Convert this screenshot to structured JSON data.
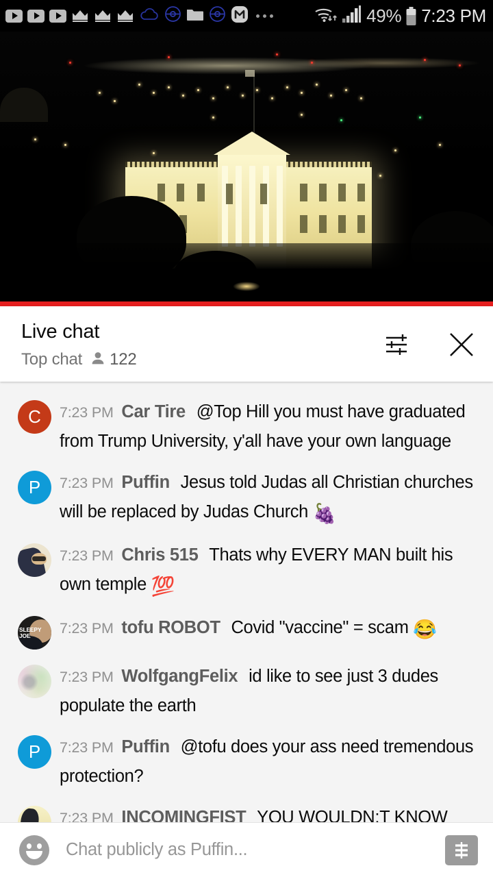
{
  "statusbar": {
    "icons": [
      "youtube-icon",
      "youtube-icon",
      "youtube-icon",
      "crown-icon",
      "crown-icon",
      "crown-icon",
      "cloud-icon",
      "pokeball-icon",
      "folder-icon",
      "pokeball-icon",
      "mega-m-icon",
      "overflow-dots-icon"
    ],
    "wifi_icon": "wifi-data-transfer-icon",
    "signal_icon": "cellular-signal-icon",
    "battery_percent": "49%",
    "battery_icon": "battery-icon",
    "time": "7:23 PM"
  },
  "video": {
    "name": "white-house-night-livestream",
    "progress_color": "#e61f1f",
    "progress_percent": 100
  },
  "chat_header": {
    "title": "Live chat",
    "mode_label": "Top chat",
    "viewer_icon": "person-icon",
    "viewer_count": "122",
    "settings_icon": "chat-settings-tune-icon",
    "close_icon": "close-icon"
  },
  "messages": [
    {
      "timestamp": "7:23 PM",
      "author": "Car Tire",
      "text": "@Top Hill you must have graduated from Trump University, y'all have your own language",
      "emoji": "",
      "avatar": {
        "kind": "initial",
        "letter": "C",
        "color": "#c43a18"
      }
    },
    {
      "timestamp": "7:23 PM",
      "author": "Puffin",
      "text": "Jesus told Judas all Christian churches will be replaced by Judas Church",
      "emoji": "🍇",
      "avatar": {
        "kind": "initial",
        "letter": "P",
        "color": "#0f9bd8"
      }
    },
    {
      "timestamp": "7:23 PM",
      "author": "Chris 515",
      "text": "Thats why EVERY MAN built his own temple",
      "emoji": "💯",
      "avatar": {
        "kind": "photo",
        "style": "chris",
        "overlay_text": ""
      }
    },
    {
      "timestamp": "7:23 PM",
      "author": "tofu ROBOT",
      "text": "Covid \"vaccine\" = scam",
      "emoji": "😂",
      "avatar": {
        "kind": "photo",
        "style": "tofu",
        "overlay_text": "SLEEPY JOE"
      }
    },
    {
      "timestamp": "7:23 PM",
      "author": "WolfgangFelix",
      "text": "id like to see just 3 dudes populate the earth",
      "emoji": "",
      "avatar": {
        "kind": "photo",
        "style": "wolf",
        "overlay_text": ""
      }
    },
    {
      "timestamp": "7:23 PM",
      "author": "Puffin",
      "text": "@tofu does your ass need tremendous protection?",
      "emoji": "",
      "avatar": {
        "kind": "initial",
        "letter": "P",
        "color": "#0f9bd8"
      }
    },
    {
      "timestamp": "7:23 PM",
      "author": "INCOMINGFIST",
      "text": "YOU WOULDN;T KNOW COOL IF IT KISSED YOU ON THE LIPS",
      "emoji": "",
      "avatar": {
        "kind": "photo",
        "style": "fist",
        "overlay_text": ""
      }
    }
  ],
  "input_bar": {
    "emoji_icon": "emoji-smiley-icon",
    "placeholder": "Chat publicly as Puffin...",
    "superchat_icon": "super-chat-dollar-icon"
  }
}
